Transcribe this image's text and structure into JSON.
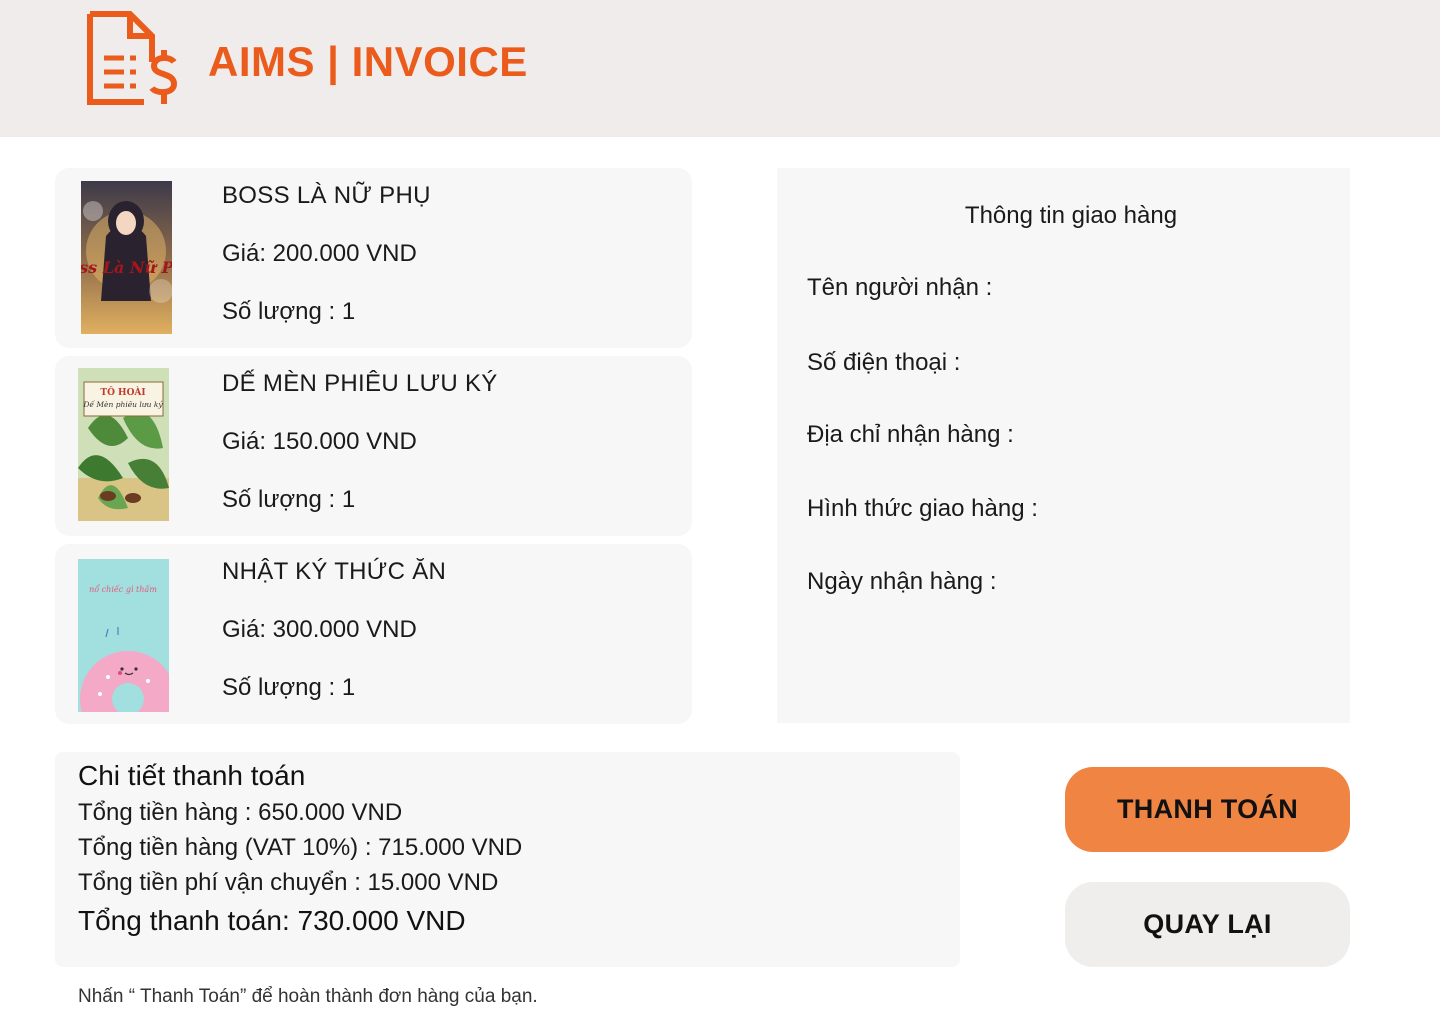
{
  "header": {
    "title": "AIMS | INVOICE",
    "logo_icon": "invoice-dollar-icon",
    "brand_color": "#ea5b1c"
  },
  "products": [
    {
      "name": "BOSS LÀ NỮ PHỤ",
      "price": "Giá: 200.000 VND",
      "quantity": "Số lượng : 1",
      "cover_text": "Boss Là Nữ Phụ"
    },
    {
      "name": "DẾ MÈN PHIÊU LƯU KÝ",
      "price": "Giá: 150.000 VND",
      "quantity": "Số lượng : 1",
      "cover_author": "TÔ HOÀI",
      "cover_text": "Dế Mèn phiêu lưu ký"
    },
    {
      "name": "NHẬT KÝ THỨC ĂN",
      "price": "Giá: 300.000 VND",
      "quantity": "Số lượng : 1",
      "cover_text": "nổ chiếc gì thấm"
    }
  ],
  "shipping": {
    "title": "Thông tin giao hàng",
    "recipient_label": "Tên người nhận :",
    "phone_label": "Số điện thoại :",
    "address_label": "Địa chỉ nhận hàng :",
    "method_label": "Hình thức giao hàng :",
    "date_label": "Ngày nhận hàng :"
  },
  "payment": {
    "title": "Chi tiết thanh toán",
    "subtotal": "Tổng tiền hàng : 650.000 VND",
    "subtotal_vat": "Tổng tiền hàng (VAT 10%) : 715.000 VND",
    "shipping_fee": "Tổng tiền phí vận chuyển : 15.000 VND",
    "total": "Tổng thanh toán: 730.000 VND"
  },
  "actions": {
    "pay_label": "THANH TOÁN",
    "back_label": "QUAY LẠI",
    "pay_color": "#f08443"
  },
  "footer": {
    "note": "Nhấn “ Thanh Toán” để hoàn thành đơn hàng của bạn."
  }
}
